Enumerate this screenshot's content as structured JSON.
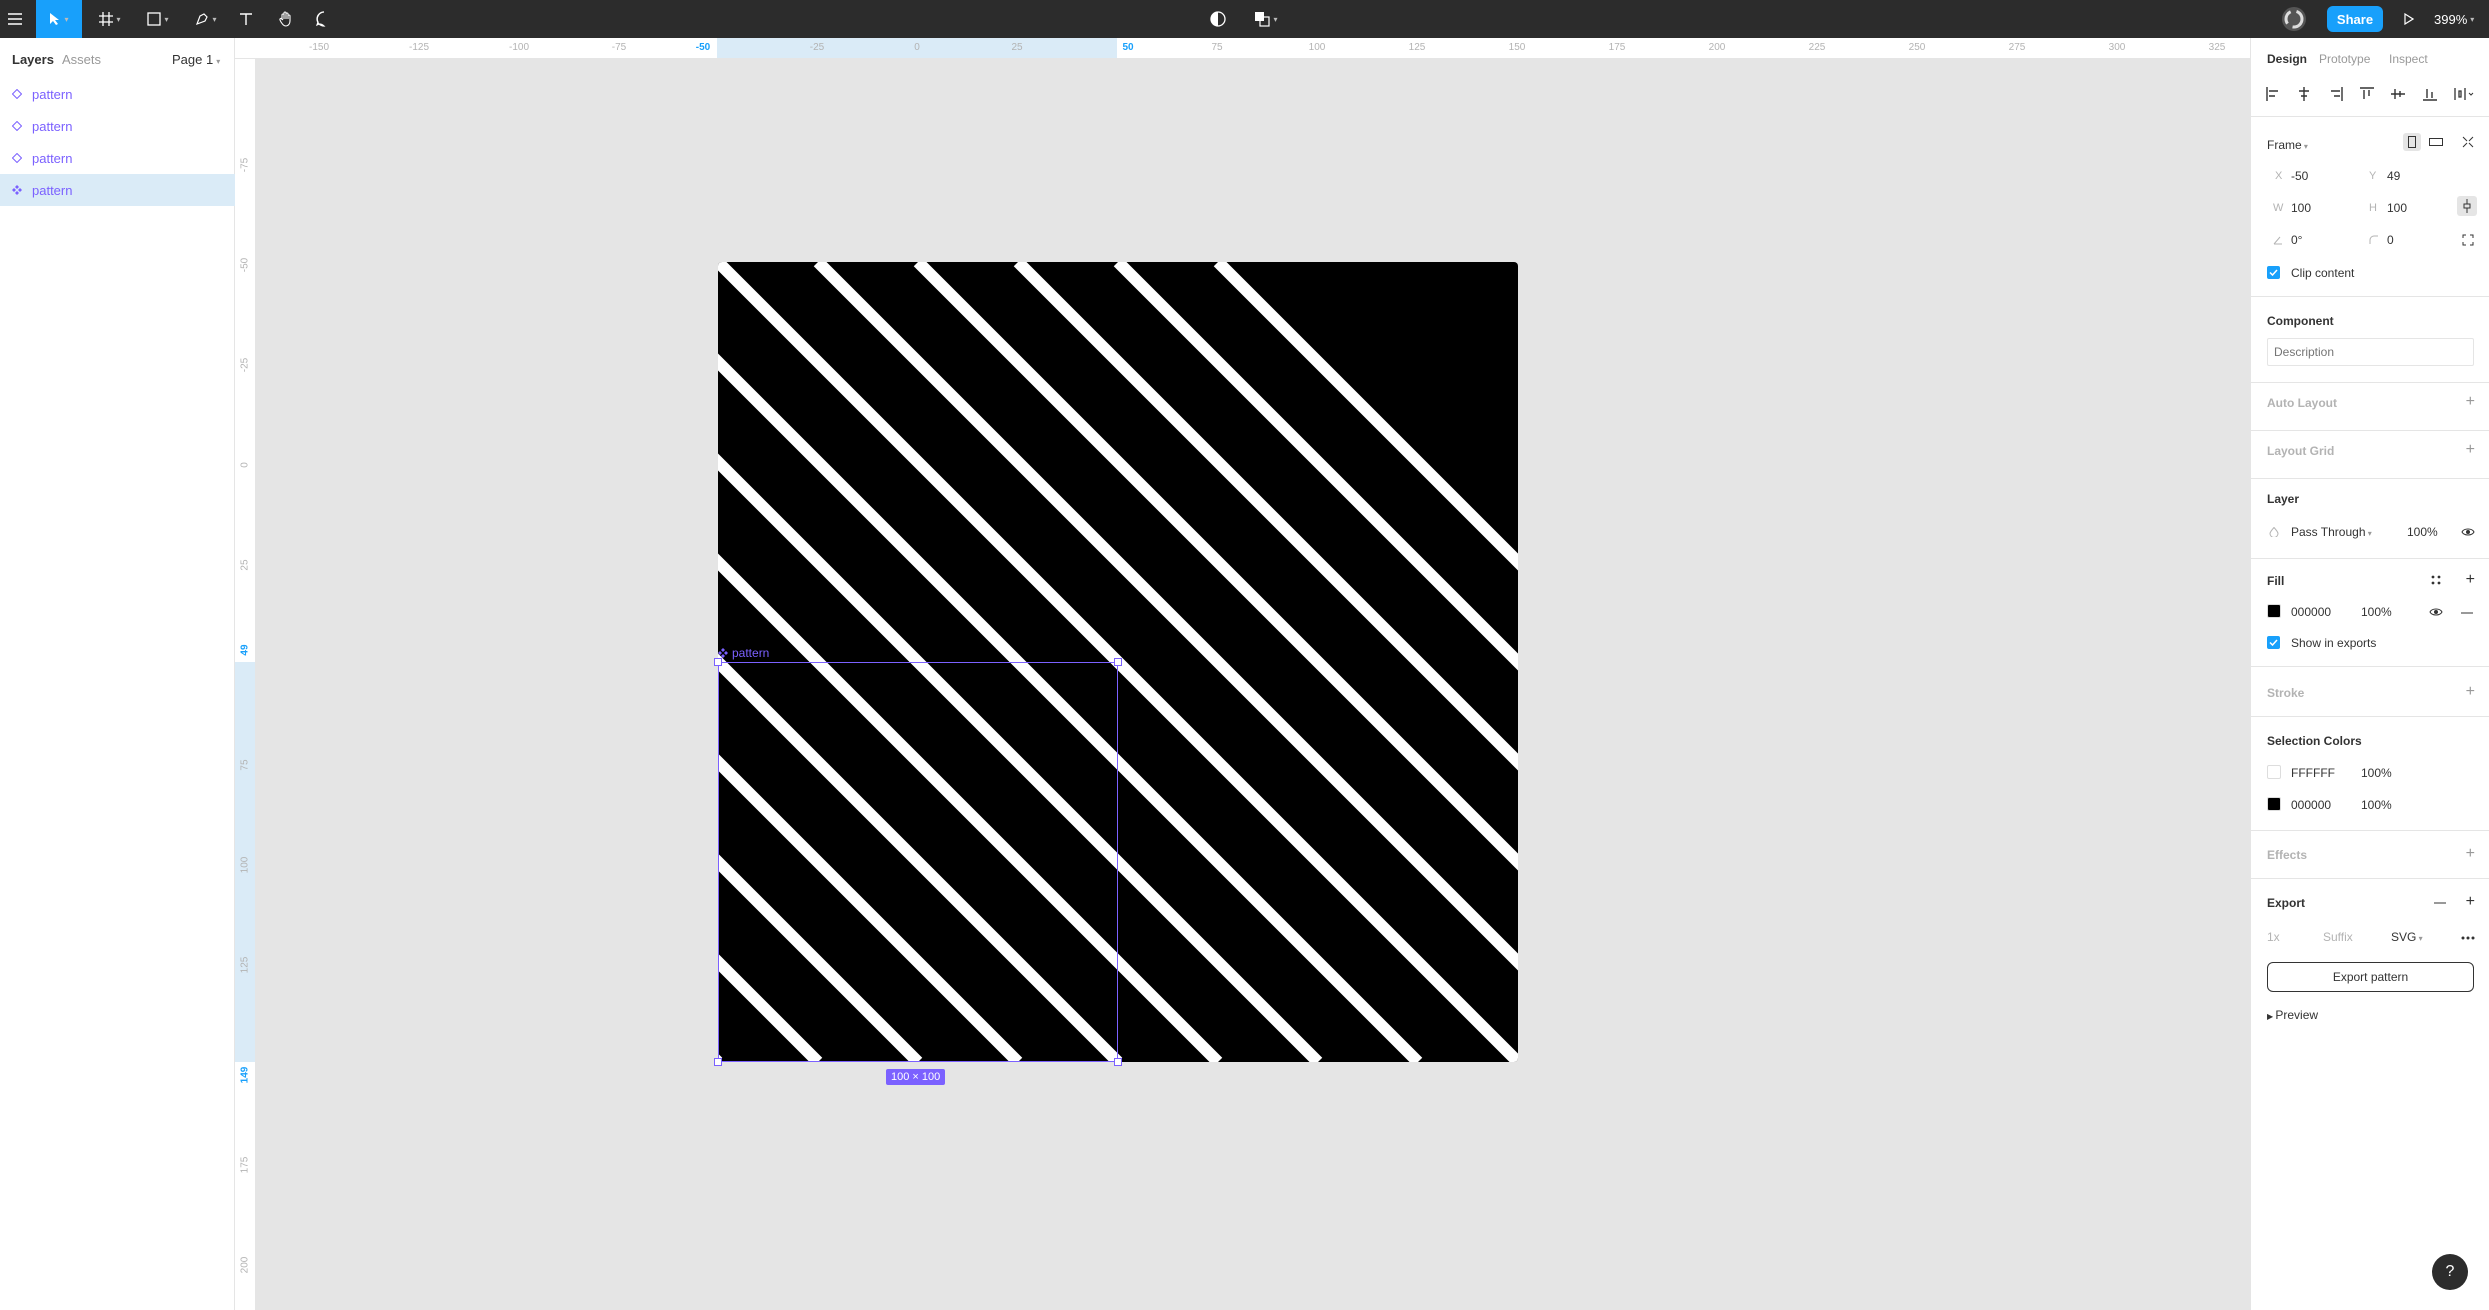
{
  "toolbar": {
    "zoom": "399%",
    "share_label": "Share"
  },
  "left_panel": {
    "tabs": [
      "Layers",
      "Assets"
    ],
    "page": "Page 1",
    "layers": [
      "pattern",
      "pattern",
      "pattern",
      "pattern"
    ],
    "selected_index": 3
  },
  "rulers": {
    "horizontal": [
      "-150",
      "-125",
      "-100",
      "-75",
      "-50",
      "-25",
      "0",
      "25",
      "50",
      "75",
      "100",
      "125",
      "150",
      "175",
      "200",
      "225",
      "250",
      "275",
      "300",
      "325"
    ],
    "horizontal_highlight": [
      "-50",
      "50"
    ],
    "vertical": [
      "-75",
      "-50",
      "-25",
      "0",
      "25",
      "49",
      "75",
      "100",
      "125",
      "149",
      "175",
      "200"
    ],
    "vertical_highlight": [
      "49",
      "149"
    ]
  },
  "canvas": {
    "selection_label": "pattern",
    "size_badge": "100 × 100",
    "fill_color": "#000000",
    "stripe_color": "#FFFFFF"
  },
  "right_panel": {
    "tabs": [
      "Design",
      "Prototype",
      "Inspect"
    ],
    "frame_label": "Frame",
    "x_label": "X",
    "x": "-50",
    "y_label": "Y",
    "y": "49",
    "w_label": "W",
    "w": "100",
    "h_label": "H",
    "h": "100",
    "rotation": "0°",
    "radius": "0",
    "clip_content": "Clip content",
    "component_title": "Component",
    "description_placeholder": "Description",
    "auto_layout": "Auto Layout",
    "layout_grid": "Layout Grid",
    "layer_title": "Layer",
    "blend_mode": "Pass Through",
    "layer_opacity": "100%",
    "fill_title": "Fill",
    "fill_hex": "000000",
    "fill_opacity": "100%",
    "show_in_exports": "Show in exports",
    "stroke_title": "Stroke",
    "selection_colors_title": "Selection Colors",
    "selection_colors": [
      {
        "hex": "FFFFFF",
        "opacity": "100%",
        "color": "#FFFFFF"
      },
      {
        "hex": "000000",
        "opacity": "100%",
        "color": "#000000"
      }
    ],
    "effects_title": "Effects",
    "export_title": "Export",
    "export_scale": "1x",
    "export_suffix": "Suffix",
    "export_format": "SVG",
    "export_button": "Export pattern",
    "preview": "Preview"
  }
}
